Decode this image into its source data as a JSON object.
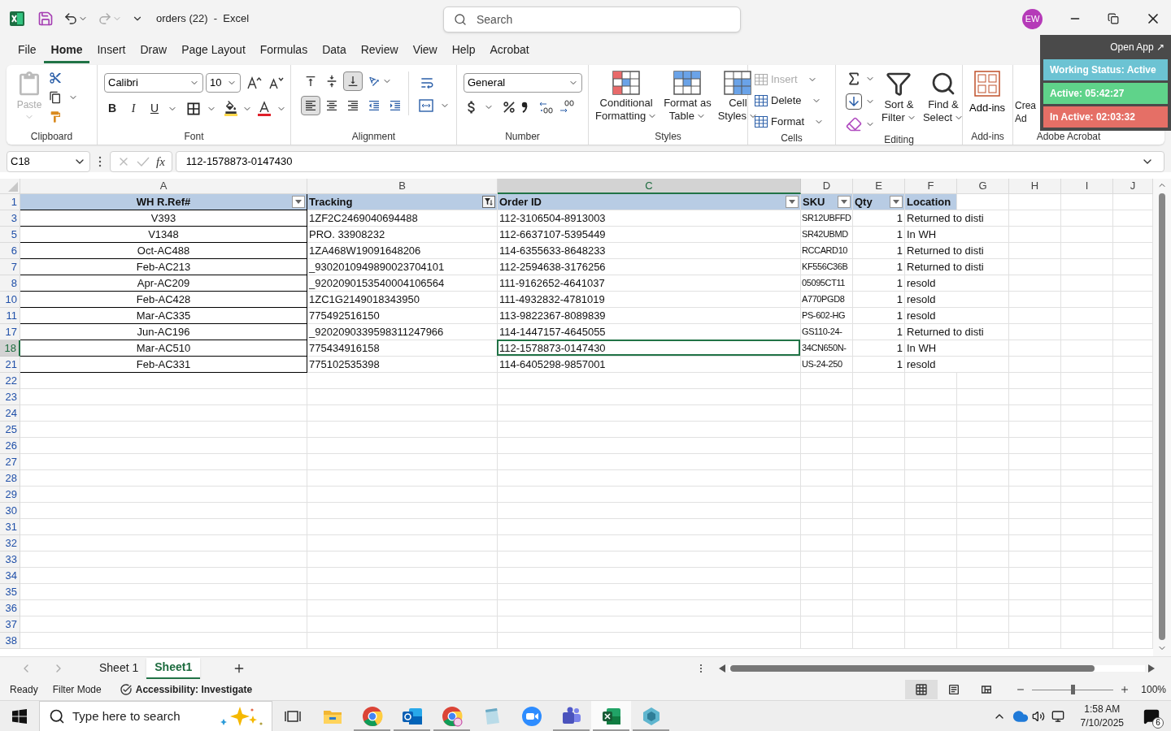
{
  "title_bar": {
    "title": "orders (22)  -  Excel",
    "search_placeholder": "Search",
    "avatar": "EW"
  },
  "menu_tabs": [
    {
      "label": "File",
      "selected": false
    },
    {
      "label": "Home",
      "selected": true
    },
    {
      "label": "Insert",
      "selected": false
    },
    {
      "label": "Draw",
      "selected": false
    },
    {
      "label": "Page Layout",
      "selected": false
    },
    {
      "label": "Formulas",
      "selected": false
    },
    {
      "label": "Data",
      "selected": false
    },
    {
      "label": "Review",
      "selected": false
    },
    {
      "label": "View",
      "selected": false
    },
    {
      "label": "Help",
      "selected": false
    },
    {
      "label": "Acrobat",
      "selected": false
    }
  ],
  "ribbon": {
    "clipboard": {
      "label": "Clipboard",
      "paste": "Paste"
    },
    "font": {
      "label": "Font",
      "font_name": "Calibri",
      "font_size": "10",
      "bold": "B",
      "italic": "I",
      "underline": "U"
    },
    "alignment": {
      "label": "Alignment",
      "vertical": [
        {
          "selected": false
        },
        {
          "selected": false
        },
        {
          "selected": true
        }
      ],
      "horizontal": [
        {
          "selected": true
        },
        {
          "selected": false
        },
        {
          "selected": false
        }
      ]
    },
    "number": {
      "label": "Number",
      "format": "General"
    },
    "styles": {
      "label": "Styles",
      "buttons": [
        {
          "lines": [
            "Conditional",
            "Formatting"
          ]
        },
        {
          "lines": [
            "Format as",
            "Table"
          ]
        },
        {
          "lines": [
            "Cell",
            "Styles"
          ]
        }
      ]
    },
    "cells": {
      "label": "Cells",
      "buttons": [
        {
          "label": "Insert",
          "disabled": true
        },
        {
          "label": "Delete",
          "disabled": false
        },
        {
          "label": "Format",
          "disabled": false
        }
      ]
    },
    "editing": {
      "label": "Editing",
      "buttons": [
        {
          "lines": [
            "Sort &",
            "Filter"
          ]
        },
        {
          "lines": [
            "Find &",
            "Select"
          ]
        }
      ]
    },
    "addins": {
      "label": "Add-ins",
      "button": "Add-ins"
    },
    "acrobat": {
      "label": "Adobe Acrobat",
      "lines": [
        "Crea",
        "Ad"
      ]
    }
  },
  "status_widget": {
    "open_app": "Open App ↗",
    "statuses": [
      {
        "text": "Working Status: Active",
        "color": "#6cc3d3"
      },
      {
        "text": "Active: 05:42:27",
        "color": "#5fd38a"
      },
      {
        "text": "In Active: 02:03:32",
        "color": "#e56f66"
      }
    ]
  },
  "formula_bar": {
    "name_box": "C18",
    "fx": "fx",
    "formula": "112-1578873-0147430"
  },
  "columns": [
    {
      "letter": "A",
      "selected": false
    },
    {
      "letter": "B",
      "selected": false
    },
    {
      "letter": "C",
      "selected": true
    },
    {
      "letter": "D",
      "selected": false
    },
    {
      "letter": "E",
      "selected": false
    },
    {
      "letter": "F",
      "selected": false
    },
    {
      "letter": "G",
      "selected": false
    },
    {
      "letter": "H",
      "selected": false
    },
    {
      "letter": "I",
      "selected": false
    },
    {
      "letter": "J",
      "selected": false
    }
  ],
  "header_row": {
    "num": "1",
    "cells": [
      {
        "text": "WH R.Ref#",
        "filter_button": true,
        "filtered": false
      },
      {
        "text": "Tracking",
        "filter_button": true,
        "filtered": true
      },
      {
        "text": "Order ID",
        "filter_button": true,
        "filtered": false
      },
      {
        "text": "SKU",
        "filter_button": true,
        "filtered": false
      },
      {
        "text": "Qty",
        "filter_button": true,
        "filtered": false
      },
      {
        "text": "Location",
        "filter_button": false
      }
    ]
  },
  "rows": [
    {
      "num": "3",
      "selected": false,
      "cells": [
        "V393",
        "1ZF2C2469040694488",
        "112-3106504-8913003",
        "SR12UBFFD",
        "1",
        "Returned to disti"
      ]
    },
    {
      "num": "5",
      "selected": false,
      "cells": [
        "V1348",
        "PRO. 33908232",
        "112-6637107-5395449",
        "SR42UBMD",
        "1",
        "In WH"
      ]
    },
    {
      "num": "6",
      "selected": false,
      "cells": [
        "Oct-AC488",
        "1ZA468W19091648206",
        "114-6355633-8648233",
        "RCCARD10",
        "1",
        "Returned to disti"
      ]
    },
    {
      "num": "7",
      "selected": false,
      "cells": [
        "Feb-AC213",
        "_9302010949890023704101",
        "112-2594638-3176256",
        "KF556C36B",
        "1",
        "Returned to disti"
      ]
    },
    {
      "num": "8",
      "selected": false,
      "cells": [
        "Apr-AC209",
        "_9202090153540004106564",
        "111-9162652-4641037",
        "05095CT11",
        "1",
        "resold"
      ]
    },
    {
      "num": "10",
      "selected": false,
      "cells": [
        "Feb-AC428",
        "1ZC1G2149018343950",
        "111-4932832-4781019",
        "A770PGD8",
        "1",
        "resold"
      ]
    },
    {
      "num": "11",
      "selected": false,
      "cells": [
        "Mar-AC335",
        "775492516150",
        "113-9822367-8089839",
        "PS-602-HG",
        "1",
        "resold"
      ]
    },
    {
      "num": "17",
      "selected": false,
      "cells": [
        "Jun-AC196",
        "_9202090339598311247966",
        "114-1447157-4645055",
        "GS110-24-",
        "1",
        "Returned to disti"
      ]
    },
    {
      "num": "18",
      "selected": true,
      "cells": [
        "Mar-AC510",
        "775434916158",
        "112-1578873-0147430",
        "34CN650N-",
        "1",
        "In WH"
      ]
    },
    {
      "num": "21",
      "selected": false,
      "cells": [
        "Feb-AC331",
        "775102535398",
        "114-6405298-9857001",
        "US-24-250",
        "1",
        "resold"
      ]
    }
  ],
  "empty_rows": [
    "22",
    "23",
    "24",
    "25",
    "26",
    "27",
    "28",
    "29",
    "30",
    "31",
    "32",
    "33",
    "34",
    "35",
    "36",
    "37",
    "38"
  ],
  "sheet_tabs": [
    {
      "label": "Sheet 1",
      "selected": false
    },
    {
      "label": "Sheet1",
      "selected": true
    }
  ],
  "status_bar": {
    "ready": "Ready",
    "mode": "Filter Mode",
    "accessibility": "Accessibility: Investigate",
    "views": [
      {
        "selected": true
      },
      {
        "selected": false
      },
      {
        "selected": false
      }
    ],
    "zoom": {
      "level": 0.5,
      "reading": "100%"
    }
  },
  "taskbar": {
    "search_placeholder": "Type here to search",
    "time": "1:58 AM",
    "date": "7/10/2025",
    "notifications": "6"
  }
}
